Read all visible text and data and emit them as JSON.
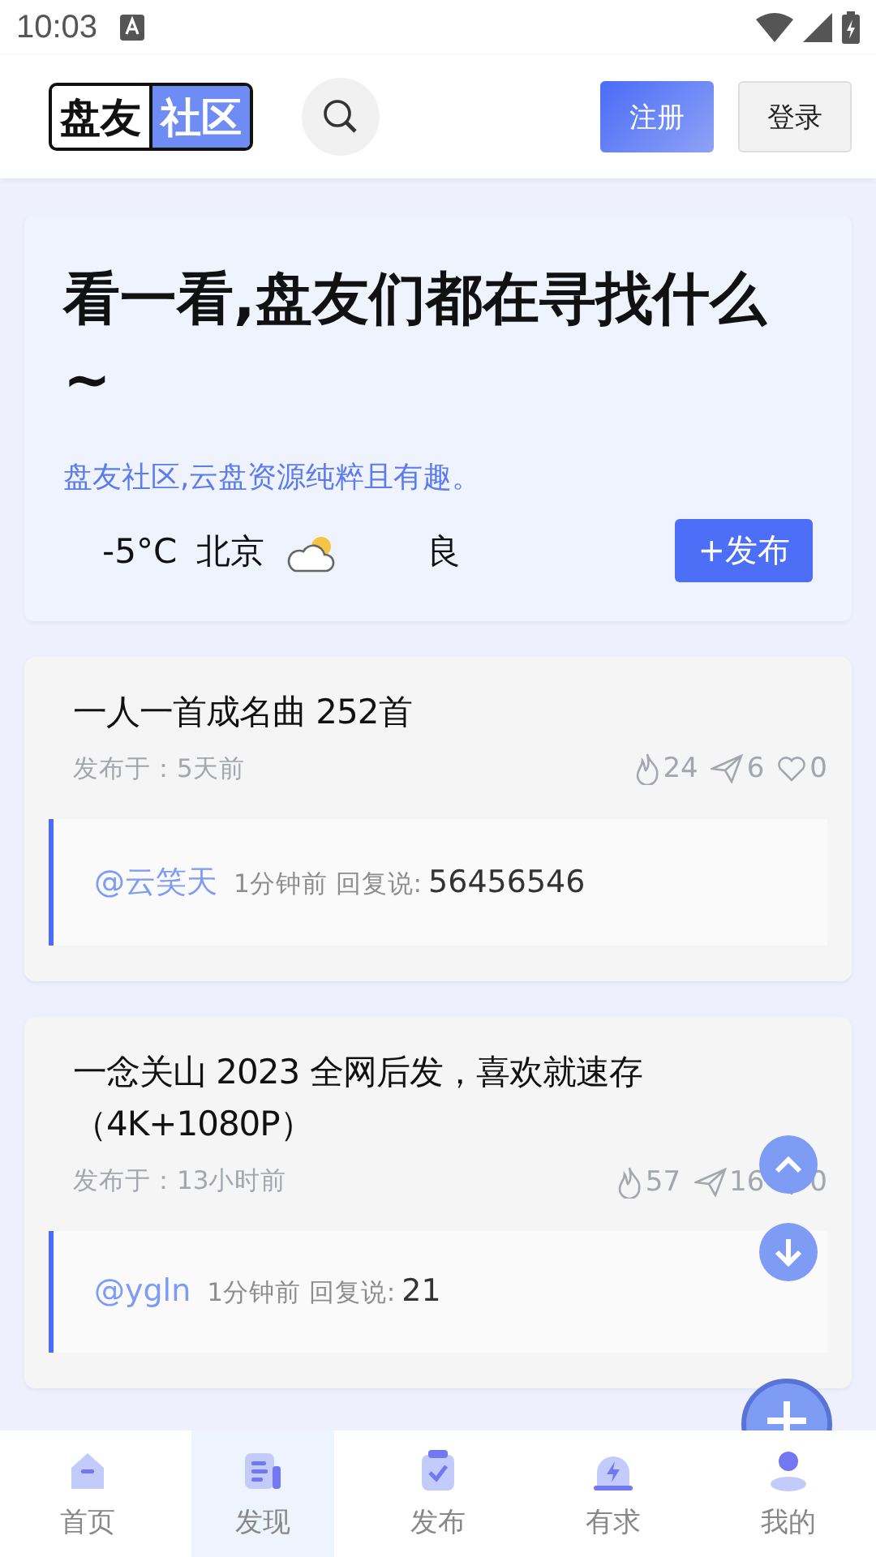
{
  "status_bar": {
    "time": "10:03"
  },
  "header": {
    "logo": [
      "盘友",
      "社区"
    ],
    "buttons": [
      {
        "label": "注册",
        "kind": "primary"
      },
      {
        "label": "登录",
        "kind": "plain"
      }
    ]
  },
  "hero": {
    "title": "看一看,盘友们都在寻找什么~",
    "subtitle": "盘友社区,云盘资源纯粹且有趣。",
    "weather": {
      "temp": "-5°C",
      "city": "北京",
      "air": "良"
    },
    "action": "+发布"
  },
  "posts": [
    {
      "title": "一人一首成名曲 252首",
      "published": "发布于：5天前",
      "stats": [
        "24",
        "6",
        "0"
      ],
      "reply": {
        "user": "@云笑天",
        "time": "1分钟前 回复说:",
        "text": "56456546"
      }
    },
    {
      "title": "一念关山 2023 全网后发，喜欢就速存（4K+1080P）",
      "published": "发布于：13小时前",
      "stats": [
        "57",
        "16",
        "0"
      ],
      "reply": {
        "user": "@ygln",
        "time": "1分钟前 回复说:",
        "text": "21"
      }
    }
  ],
  "nav": [
    {
      "label": "首页",
      "kind": "home",
      "selected": false
    },
    {
      "label": "发现",
      "kind": "discover",
      "selected": true
    },
    {
      "label": "发布",
      "kind": "publish",
      "selected": false
    },
    {
      "label": "有求",
      "kind": "request",
      "selected": false
    },
    {
      "label": "我的",
      "kind": "me",
      "selected": false
    }
  ]
}
